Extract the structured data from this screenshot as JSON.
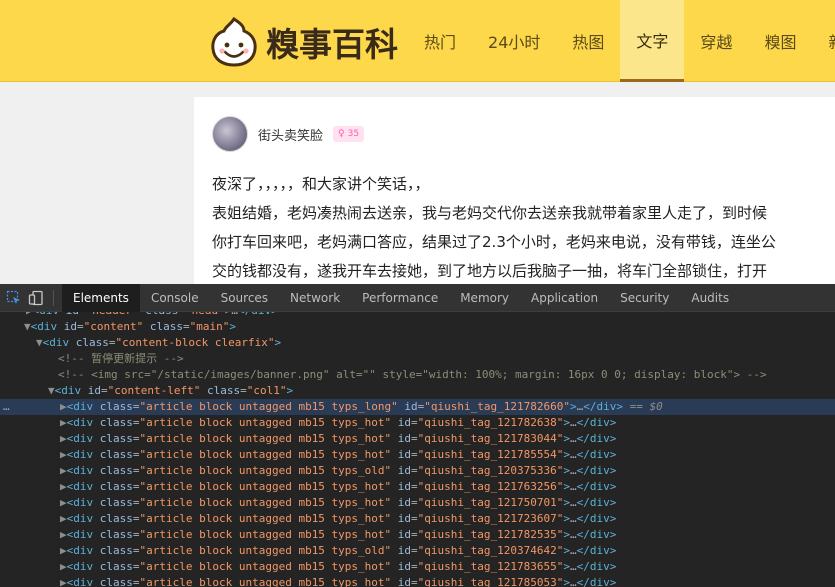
{
  "site": {
    "logo_text": "糗事百科",
    "nav": [
      "热门",
      "24小时",
      "热图",
      "文字",
      "穿越",
      "糗图",
      "新鲜"
    ],
    "active_nav_index": 3,
    "colors": {
      "header_bg": "#fdd84a",
      "active_tab_bg": "#fbe68c",
      "active_tab_underline": "#9b6a1f"
    }
  },
  "article": {
    "author": "街头卖笑脸",
    "age": "35",
    "lines": [
      "夜深了，，，，，和大家讲个笑话，，",
      "表姐结婚，老妈凑热闹去送亲，我与老妈交代你去送亲我就带着家里人走了，到时候",
      "你打车回来吧，老妈满口答应，结果过了2.3个小时，老妈来电说，没有带钱，连坐公",
      "交的钱都没有，遂我开车去接她，到了地方以后我脑子一抽，将车门全部锁住，打开"
    ]
  },
  "devtools": {
    "tabs": [
      "Elements",
      "Console",
      "Sources",
      "Network",
      "Performance",
      "Memory",
      "Application",
      "Security",
      "Audits"
    ],
    "active_tab": "Elements",
    "icons": [
      "inspect-element-icon",
      "device-toolbar-icon"
    ],
    "tree": {
      "header_line": {
        "tag": "div",
        "id": "header",
        "class": "head"
      },
      "content_div": {
        "tag": "div",
        "id": "content",
        "class": "main"
      },
      "content_block": {
        "tag": "div",
        "class": "content-block clearfix"
      },
      "comment1": "<!-- 暂停更新提示 -->",
      "comment2": "<!-- <img src=\"/static/images/banner.png\" alt=\"\" style=\"width: 100%; margin: 16px 0 0; display: block\"> -->",
      "content_left": {
        "tag": "div",
        "id": "content-left",
        "class": "col1"
      },
      "selected_marker": "== $0",
      "articles": [
        {
          "class": "article block untagged mb15 typs_long",
          "id": "qiushi_tag_121782660"
        },
        {
          "class": "article block untagged mb15 typs_hot",
          "id": "qiushi_tag_121782638"
        },
        {
          "class": "article block untagged mb15 typs_hot",
          "id": "qiushi_tag_121783044"
        },
        {
          "class": "article block untagged mb15 typs_hot",
          "id": "qiushi_tag_121785554"
        },
        {
          "class": "article block untagged mb15 typs_old",
          "id": "qiushi_tag_120375336"
        },
        {
          "class": "article block untagged mb15 typs_hot",
          "id": "qiushi_tag_121763256"
        },
        {
          "class": "article block untagged mb15 typs_hot",
          "id": "qiushi_tag_121750701"
        },
        {
          "class": "article block untagged mb15 typs_hot",
          "id": "qiushi_tag_121723607"
        },
        {
          "class": "article block untagged mb15 typs_hot",
          "id": "qiushi_tag_121782535"
        },
        {
          "class": "article block untagged mb15 typs_old",
          "id": "qiushi_tag_120374642"
        },
        {
          "class": "article block untagged mb15 typs_hot",
          "id": "qiushi_tag_121783655"
        },
        {
          "class": "article block untagged mb15 typs_hot",
          "id": "qiushi_tag_121785053"
        }
      ]
    }
  }
}
